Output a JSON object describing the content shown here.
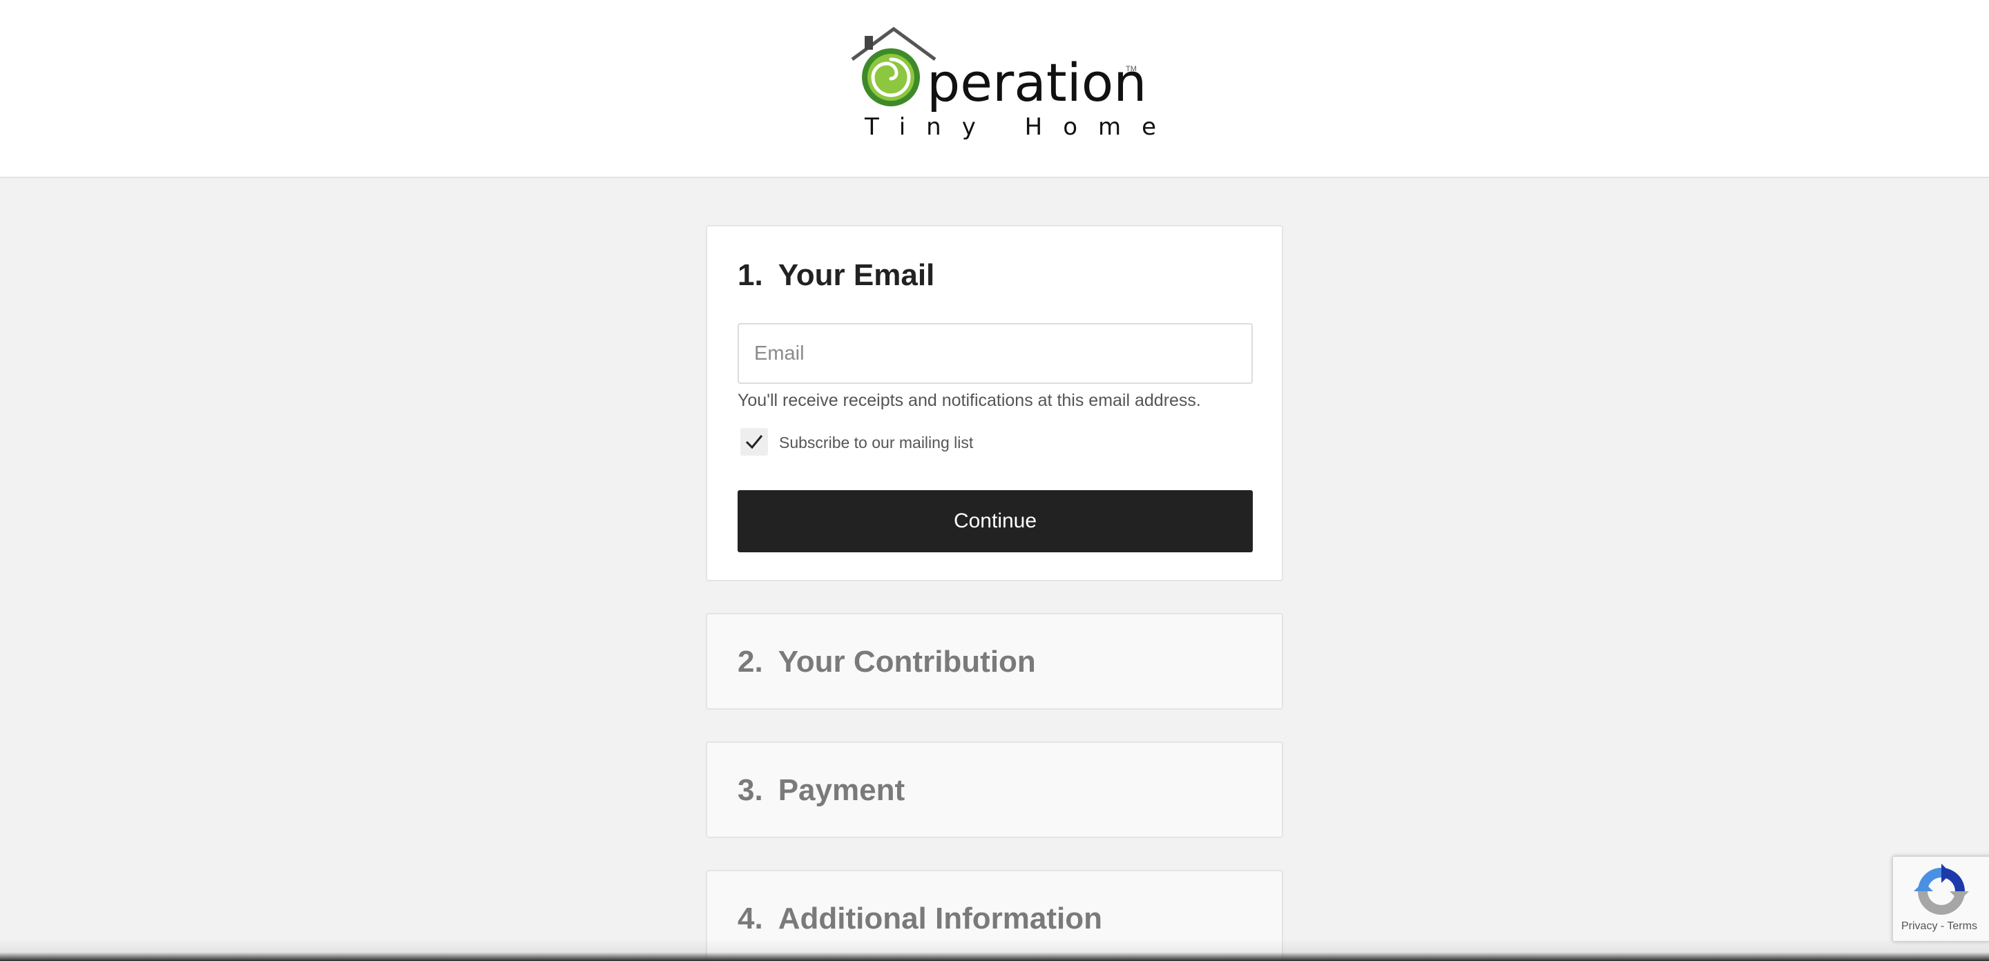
{
  "header": {
    "logo": {
      "word": "peration",
      "tm": "TM",
      "subtitle": "Tiny Home",
      "icon": "house-swirl-icon",
      "colors": {
        "green_dark": "#3e8a2a",
        "green_light": "#8dc63f",
        "roof": "#555555"
      }
    }
  },
  "steps": [
    {
      "number": "1.",
      "title": "Your Email",
      "active": true,
      "email_placeholder": "Email",
      "email_value": "",
      "helper_text": "You'll receive receipts and notifications at this email address.",
      "subscribe_label": "Subscribe to our mailing list",
      "subscribe_checked": true,
      "continue_label": "Continue"
    },
    {
      "number": "2.",
      "title": "Your Contribution",
      "active": false
    },
    {
      "number": "3.",
      "title": "Payment",
      "active": false
    },
    {
      "number": "4.",
      "title": "Additional Information",
      "active": false
    }
  ],
  "recaptcha": {
    "icon": "recaptcha-icon",
    "privacy_label": "Privacy",
    "separator": " - ",
    "terms_label": "Terms"
  },
  "theme": {
    "page_bg": "#f2f2f2",
    "button_bg": "#222222",
    "collapsed_text": "#7a7a7a"
  }
}
